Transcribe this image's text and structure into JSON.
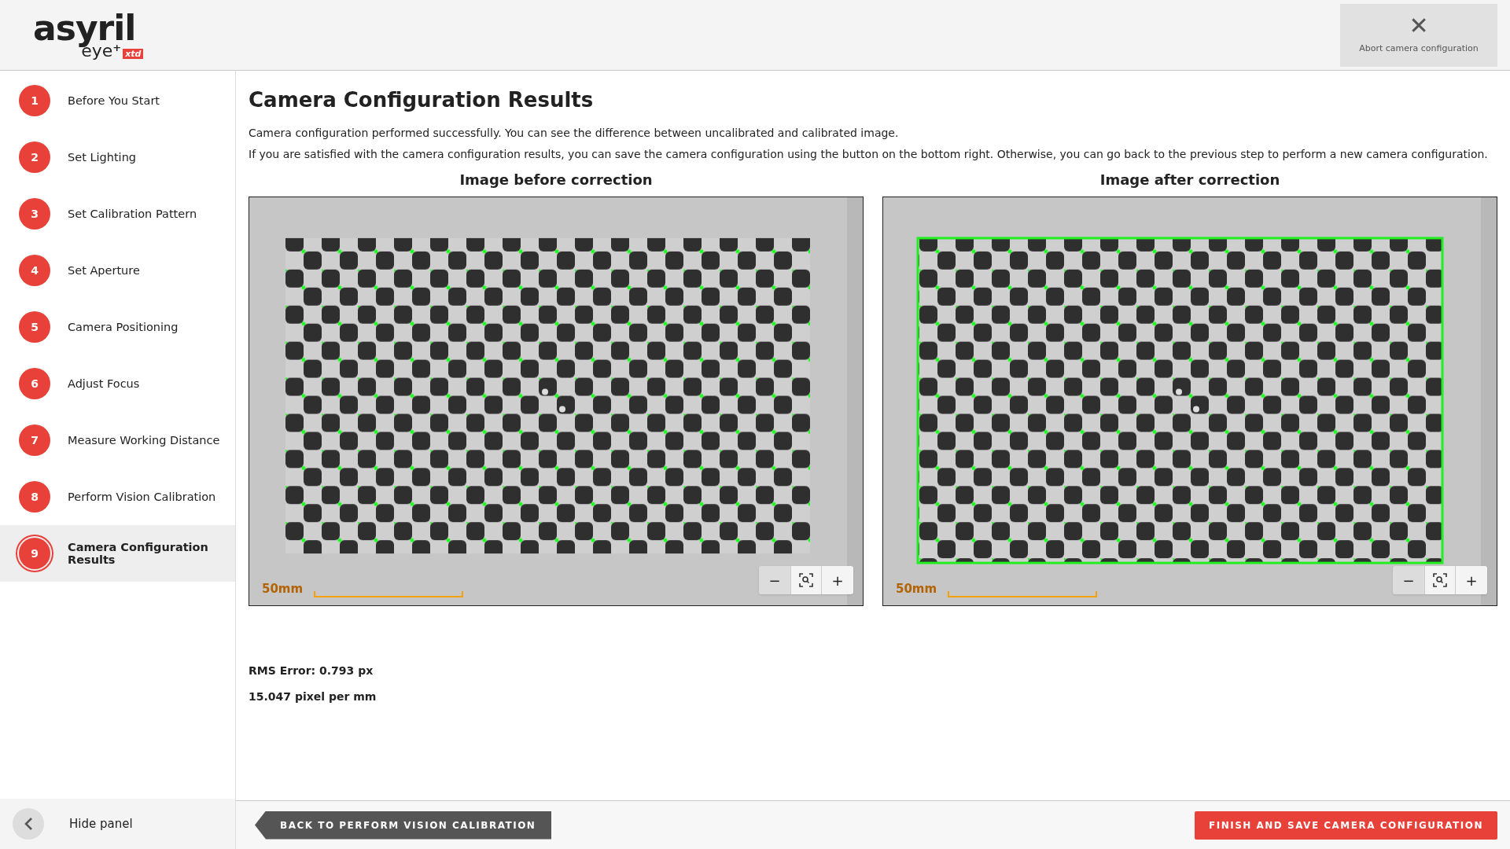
{
  "header": {
    "logo": {
      "word": "asyril",
      "sub": "eye",
      "sup": "+",
      "tag": "xtd"
    },
    "abort_button": {
      "icon": "✕",
      "label": "Abort camera configuration"
    }
  },
  "sidebar": {
    "steps": [
      {
        "number": "1",
        "label": "Before You Start",
        "selected": false
      },
      {
        "number": "2",
        "label": "Set Lighting",
        "selected": false
      },
      {
        "number": "3",
        "label": "Set Calibration Pattern",
        "selected": false
      },
      {
        "number": "4",
        "label": "Set Aperture",
        "selected": false
      },
      {
        "number": "5",
        "label": "Camera Positioning",
        "selected": false
      },
      {
        "number": "6",
        "label": "Adjust Focus",
        "selected": false
      },
      {
        "number": "7",
        "label": "Measure Working Distance",
        "selected": false
      },
      {
        "number": "8",
        "label": "Perform Vision Calibration",
        "selected": false
      },
      {
        "number": "9",
        "label": "Camera Configuration Results",
        "selected": true
      }
    ],
    "hide_panel": "Hide panel"
  },
  "content": {
    "title": "Camera Configuration Results",
    "description": [
      "Camera configuration performed successfully. You can see the difference between uncalibrated and calibrated image.",
      "If you are satisfied with the camera configuration results, you can save the camera configuration using the button on the bottom right. Otherwise, you can go back to the previous step to perform a new camera configuration."
    ],
    "images": [
      {
        "heading": "Image before correction",
        "kind": "picture",
        "scale_label": "50mm",
        "zoom_out": "−",
        "zoom_in": "+"
      },
      {
        "heading": "Image after correction",
        "kind": "picture",
        "scale_label": "50mm",
        "zoom_out": "−",
        "zoom_in": "+"
      }
    ],
    "metrics": [
      "RMS Error: 0.793 px",
      "15.047 pixel per mm"
    ]
  },
  "footer": {
    "back_button": "BACK TO PERFORM VISION CALIBRATION",
    "finish_button": "FINISH AND SAVE CAMERA CONFIGURATION"
  }
}
